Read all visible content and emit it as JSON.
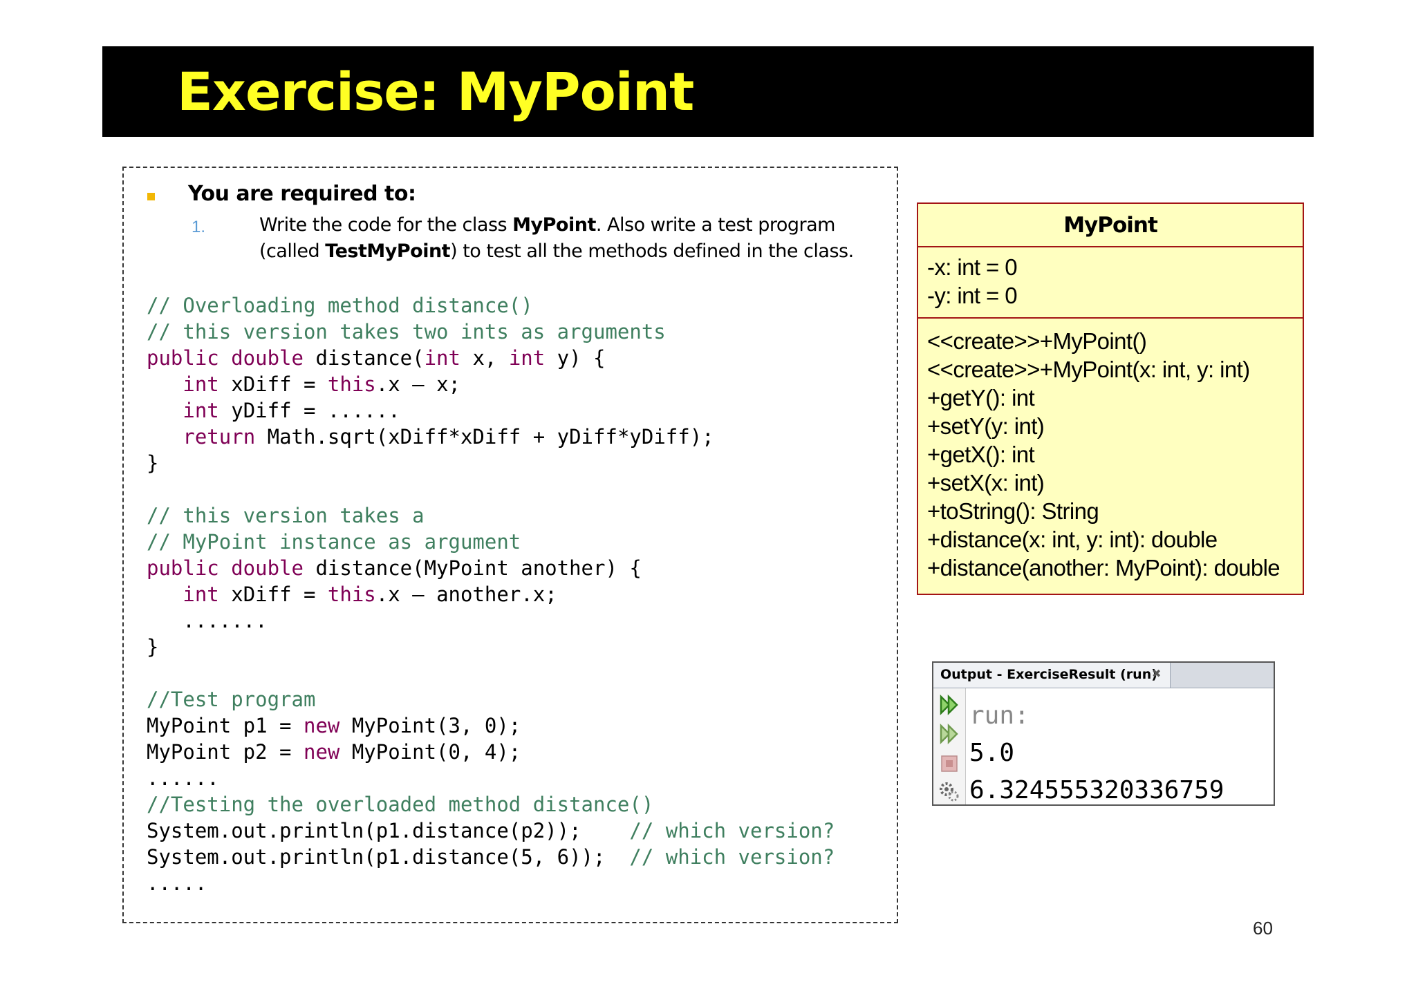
{
  "title": "Exercise: MyPoint",
  "task": {
    "heading": "You are required to:",
    "item_number": "1.",
    "item_text_1": "Write the code for the class ",
    "item_bold_1": "MyPoint",
    "item_text_2": ". Also write a test program (called ",
    "item_bold_2": "TestMyPoint",
    "item_text_3": ") to test all the methods defined in the class."
  },
  "code_lines": [
    [
      {
        "t": "// Overloading method distance()",
        "s": "cm"
      }
    ],
    [
      {
        "t": "// this version takes two ints as arguments",
        "s": "cm"
      }
    ],
    [
      {
        "t": "public double",
        "s": "kw"
      },
      {
        "t": " distance(",
        "s": ""
      },
      {
        "t": "int",
        "s": "kw"
      },
      {
        "t": " x, ",
        "s": ""
      },
      {
        "t": "int",
        "s": "kw"
      },
      {
        "t": " y) {",
        "s": ""
      }
    ],
    [
      {
        "t": "   ",
        "s": ""
      },
      {
        "t": "int",
        "s": "kw"
      },
      {
        "t": " xDiff = ",
        "s": ""
      },
      {
        "t": "this",
        "s": "kw"
      },
      {
        "t": ".x – x;",
        "s": ""
      }
    ],
    [
      {
        "t": "   ",
        "s": ""
      },
      {
        "t": "int",
        "s": "kw"
      },
      {
        "t": " yDiff = ......",
        "s": ""
      }
    ],
    [
      {
        "t": "   ",
        "s": ""
      },
      {
        "t": "return",
        "s": "kw"
      },
      {
        "t": " Math.sqrt(xDiff*xDiff + yDiff*yDiff);",
        "s": ""
      }
    ],
    [
      {
        "t": "}",
        "s": ""
      }
    ],
    [
      {
        "t": "",
        "s": ""
      }
    ],
    [
      {
        "t": "// this version takes a",
        "s": "cm"
      }
    ],
    [
      {
        "t": "// MyPoint instance as argument",
        "s": "cm"
      }
    ],
    [
      {
        "t": "public double",
        "s": "kw"
      },
      {
        "t": " distance(MyPoint another) {",
        "s": ""
      }
    ],
    [
      {
        "t": "   ",
        "s": ""
      },
      {
        "t": "int",
        "s": "kw"
      },
      {
        "t": " xDiff = ",
        "s": ""
      },
      {
        "t": "this",
        "s": "kw"
      },
      {
        "t": ".x – another.x;",
        "s": ""
      }
    ],
    [
      {
        "t": "   .......",
        "s": ""
      }
    ],
    [
      {
        "t": "}",
        "s": ""
      }
    ],
    [
      {
        "t": "",
        "s": ""
      }
    ],
    [
      {
        "t": "//Test program",
        "s": "cm"
      }
    ],
    [
      {
        "t": "MyPoint p1 = ",
        "s": ""
      },
      {
        "t": "new",
        "s": "kw"
      },
      {
        "t": " MyPoint(3, 0);",
        "s": ""
      }
    ],
    [
      {
        "t": "MyPoint p2 = ",
        "s": ""
      },
      {
        "t": "new",
        "s": "kw"
      },
      {
        "t": " MyPoint(0, 4);",
        "s": ""
      }
    ],
    [
      {
        "t": "......",
        "s": ""
      }
    ],
    [
      {
        "t": "//Testing the overloaded method distance()",
        "s": "cm"
      }
    ],
    [
      {
        "t": "System.out.println(p1.distance(p2));    ",
        "s": ""
      },
      {
        "t": "// which version?",
        "s": "cm"
      }
    ],
    [
      {
        "t": "System.out.println(p1.distance(5, 6));  ",
        "s": ""
      },
      {
        "t": "// which version?",
        "s": "cm"
      }
    ],
    [
      {
        "t": ".....",
        "s": ""
      }
    ]
  ],
  "uml": {
    "class_name": "MyPoint",
    "attributes": [
      "-x: int = 0",
      "-y: int = 0"
    ],
    "operations": [
      "<<create>>+MyPoint()",
      "<<create>>+MyPoint(x: int, y: int)",
      "+getY(): int",
      "+setY(y: int)",
      "+getX(): int",
      "+setX(x: int)",
      "+toString(): String",
      "+distance(x: int, y: int): double",
      "+distance(another: MyPoint): double"
    ]
  },
  "output": {
    "tab_label": "Output - ExerciseResult (run)",
    "lines": [
      "run:",
      "5.0",
      "6.324555320336759"
    ]
  },
  "page_number": "60",
  "colors": {
    "title_text": "#ffff24",
    "title_background": "#000000",
    "code_comment": "#3f7f5f",
    "code_keyword": "#7f0055",
    "uml_fill": "#ffffc0",
    "uml_border": "#a31515"
  },
  "icons": [
    "run-again-icon",
    "run-again-icon",
    "stop-icon",
    "settings-icon",
    "close-icon"
  ]
}
